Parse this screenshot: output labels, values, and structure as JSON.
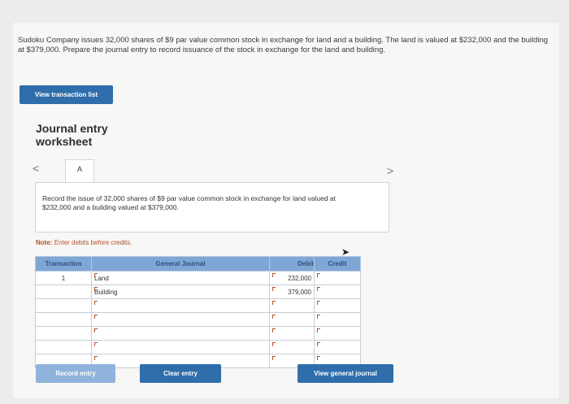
{
  "problem": {
    "text": "Sudoku Company issues 32,000 shares of $9 par value common stock in exchange for land and a building. The land is valued at $232,000 and the building at $379,000. Prepare the journal entry to record issuance of the stock in exchange for the land and building."
  },
  "buttons": {
    "view_transaction_list": "View transaction list",
    "record_entry": "Record entry",
    "clear_entry": "Clear entry",
    "view_general_journal": "View general journal"
  },
  "worksheet": {
    "title": "Journal entry worksheet",
    "prev": "<",
    "next": ">",
    "tab": "A",
    "instruction": "Record the issue of 32,000 shares of $9 par value common stock in exchange for land valued at $232,000 and a building valued at $379,000.",
    "note_label": "Note:",
    "note_text": "Enter debits before credits."
  },
  "table": {
    "headers": {
      "transaction": "Transaction",
      "general_journal": "General Journal",
      "debit": "Debit",
      "credit": "Credit"
    },
    "rows": [
      {
        "transaction": "1",
        "account": "Land",
        "debit": "232,000",
        "credit": ""
      },
      {
        "transaction": "",
        "account": "Building",
        "debit": "379,000",
        "credit": ""
      },
      {
        "transaction": "",
        "account": "",
        "debit": "",
        "credit": ""
      },
      {
        "transaction": "",
        "account": "",
        "debit": "",
        "credit": ""
      },
      {
        "transaction": "",
        "account": "",
        "debit": "",
        "credit": ""
      },
      {
        "transaction": "",
        "account": "",
        "debit": "",
        "credit": ""
      },
      {
        "transaction": "",
        "account": "",
        "debit": "",
        "credit": ""
      }
    ]
  }
}
